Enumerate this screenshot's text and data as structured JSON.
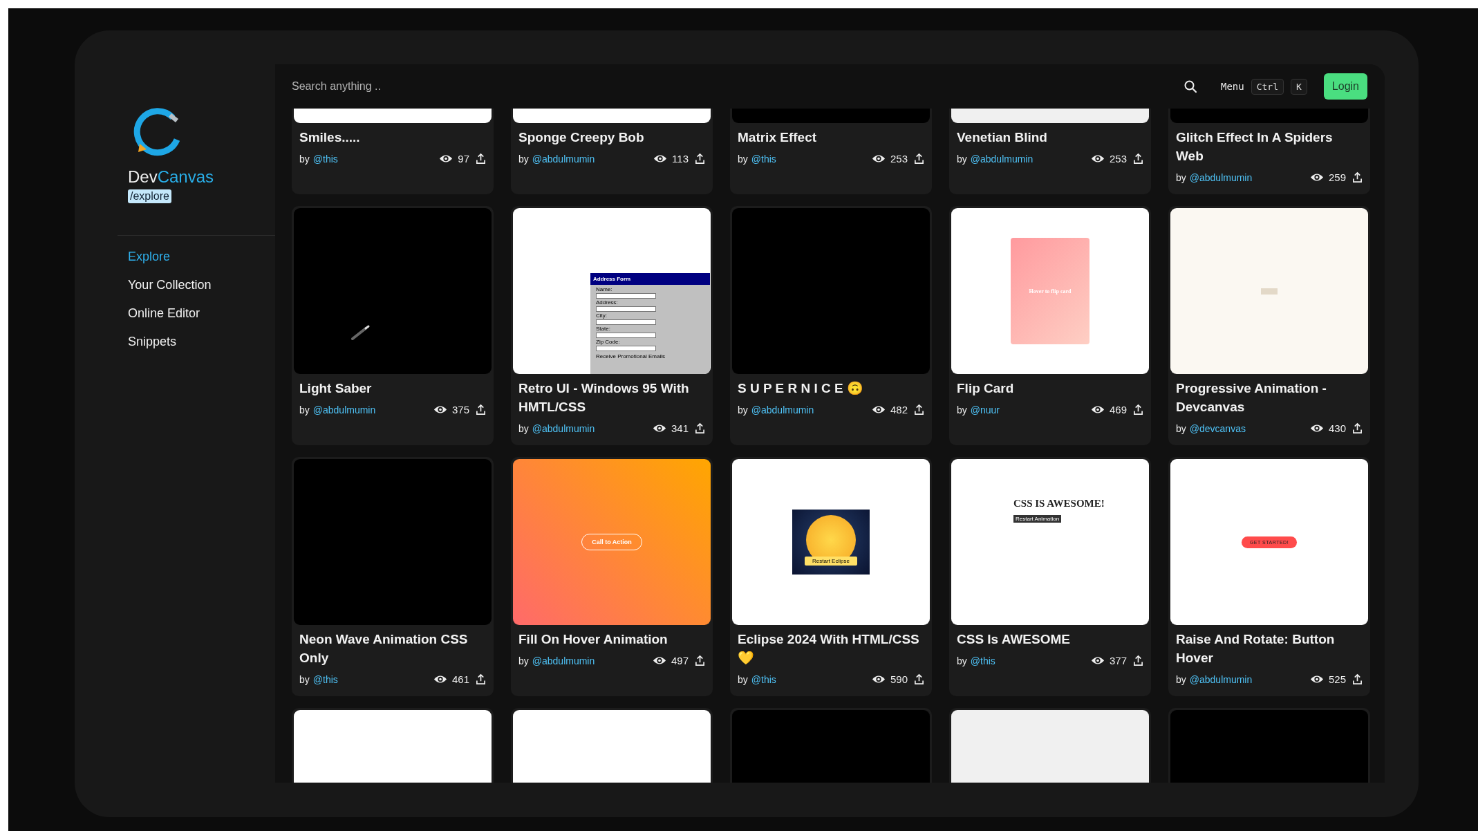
{
  "brand": {
    "name_first": "Dev",
    "name_second": "Canvas",
    "path": "/explore"
  },
  "nav": [
    {
      "label": "Explore",
      "selected": true
    },
    {
      "label": "Your Collection",
      "selected": false
    },
    {
      "label": "Online Editor",
      "selected": false
    },
    {
      "label": "Snippets",
      "selected": false
    }
  ],
  "topbar": {
    "search": {
      "placeholder": "Search anything .."
    },
    "menu_label": "Menu",
    "shortcut_keys": [
      "Ctrl",
      "K"
    ],
    "login_button": "Login"
  },
  "cards": [
    {
      "title": "Smiles.....",
      "by": "by",
      "author": "@this",
      "views": "97",
      "preview": {
        "kind": "white"
      }
    },
    {
      "title": "Sponge Creepy Bob",
      "by": "by",
      "author": "@abdulmumin",
      "views": "113",
      "preview": {
        "kind": "white"
      }
    },
    {
      "title": "Matrix Effect",
      "by": "by",
      "author": "@this",
      "views": "253",
      "preview": {
        "kind": "black"
      }
    },
    {
      "title": "Venetian Blind",
      "by": "by",
      "author": "@abdulmumin",
      "views": "253",
      "preview": {
        "kind": "light"
      }
    },
    {
      "title": "Glitch Effect In A Spiders Web",
      "by": "by",
      "author": "@abdulmumin",
      "views": "259",
      "preview": {
        "kind": "black"
      }
    },
    {
      "title": "Light Saber",
      "by": "by",
      "author": "@abdulmumin",
      "views": "375",
      "preview": {
        "kind": "saber"
      }
    },
    {
      "title": "Retro UI -  Windows 95 With HMTL/CSS",
      "by": "by",
      "author": "@abdulmumin",
      "views": "341",
      "preview": {
        "kind": "retro-form",
        "heading": "Address Form",
        "labels": [
          "Name:",
          "Address:",
          "City:",
          "State:",
          "Zip Code:"
        ],
        "checkbox": "Receive Promotional Emails"
      }
    },
    {
      "title": "S U P E R N I C E 🙃",
      "by": "by",
      "author": "@abdulmumin",
      "views": "482",
      "preview": {
        "kind": "black"
      }
    },
    {
      "title": "Flip Card",
      "by": "by",
      "author": "@nuur",
      "views": "469",
      "preview": {
        "kind": "flip-card",
        "heading": "Hover to flip card"
      }
    },
    {
      "title": "Progressive Animation - Devcanvas",
      "by": "by",
      "author": "@devcanvas",
      "views": "430",
      "preview": {
        "kind": "cream-button"
      }
    },
    {
      "title": "Neon Wave Animation CSS Only",
      "by": "by",
      "author": "@this",
      "views": "461",
      "preview": {
        "kind": "black"
      }
    },
    {
      "title": "Fill On Hover Animation",
      "by": "by",
      "author": "@abdulmumin",
      "views": "497",
      "preview": {
        "kind": "gradient-button",
        "button": "Call to Action"
      }
    },
    {
      "title": "Eclipse 2024  With HTML/CSS 💛",
      "by": "by",
      "author": "@this",
      "views": "590",
      "preview": {
        "kind": "eclipse",
        "button": "Restart Eclipse"
      }
    },
    {
      "title": "CSS Is AWESOME",
      "by": "by",
      "author": "@this",
      "views": "377",
      "preview": {
        "kind": "heading-button",
        "heading": "CSS IS AWESOME!",
        "button": "Restart Animation"
      }
    },
    {
      "title": "Raise And Rotate: Button Hover",
      "by": "by",
      "author": "@abdulmumin",
      "views": "525",
      "preview": {
        "kind": "pill-button",
        "button": "GET STARTED!"
      }
    },
    {
      "preview": {
        "kind": "white"
      }
    },
    {
      "preview": {
        "kind": "white"
      }
    },
    {
      "preview": {
        "kind": "black"
      }
    },
    {
      "preview": {
        "kind": "dot"
      }
    },
    {
      "preview": {
        "kind": "black"
      }
    }
  ]
}
